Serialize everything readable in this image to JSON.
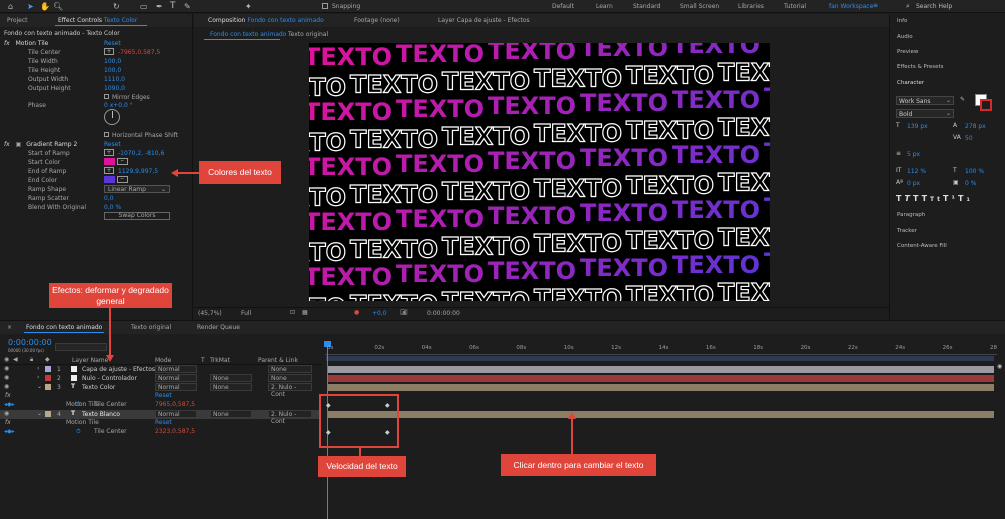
{
  "toolbar": {
    "snapping_label": "Snapping",
    "workspaces": [
      "Default",
      "Learn",
      "Standard",
      "Small Screen",
      "Libraries",
      "Tutorial"
    ],
    "active_workspace": "fan Workspace",
    "search_placeholder": "Search Help"
  },
  "left_panel": {
    "tab_project": "Project",
    "tab_effect_controls_prefix": "Effect Controls",
    "tab_effect_controls_layer": "Texto Color",
    "header": "Fondo con texto animado - Texto Color",
    "motion_tile": {
      "name": "Motion Tile",
      "reset": "Reset",
      "props": [
        {
          "label": "Tile Center",
          "value": "-7965,0,587,5",
          "color": "red",
          "crosshair": true
        },
        {
          "label": "Tile Width",
          "value": "100,0"
        },
        {
          "label": "Tile Height",
          "value": "100,0"
        },
        {
          "label": "Output Width",
          "value": "1110,0"
        },
        {
          "label": "Output Height",
          "value": "1090,0"
        }
      ],
      "mirror_edges": "Mirror Edges",
      "phase_label": "Phase",
      "phase_value": "0 x+0,0 °",
      "horizontal_phase_shift": "Horizontal Phase Shift"
    },
    "gradient_ramp": {
      "name": "Gradient Ramp 2",
      "reset": "Reset",
      "start_of_ramp_label": "Start of Ramp",
      "start_of_ramp_value": "-1070,2, -810,6",
      "start_color_label": "Start Color",
      "end_of_ramp_label": "End of Ramp",
      "end_of_ramp_value": "1129,9,997,5",
      "end_color_label": "End Color",
      "ramp_shape_label": "Ramp Shape",
      "ramp_shape_value": "Linear Ramp",
      "ramp_scatter_label": "Ramp Scatter",
      "ramp_scatter_value": "0,0",
      "blend_label": "Blend With Original",
      "blend_value": "0,0 %",
      "swap_colors": "Swap Colors",
      "start_color": "#e0119a",
      "end_color": "#5a35d8"
    }
  },
  "composition": {
    "tab_prefix": "Composition",
    "tab_name": "Fondo con texto animado",
    "footage_tab": "Footage (none)",
    "layer_tab": "Layer Capa de ajuste - Efectos",
    "subtab_active": "Fondo con texto animado",
    "subtab_other": "Texto original",
    "zoom": "(45,7%)",
    "resolution": "Full",
    "exposure": "+0,0",
    "timecode": "0:00:00:00",
    "tile_word": "TEXTO"
  },
  "right_panel": {
    "items_top": [
      "Info",
      "Audio",
      "Preview",
      "Effects & Presets"
    ],
    "character_title": "Character",
    "font_family": "Work Sans",
    "font_style": "Bold",
    "font_size": "139 px",
    "leading": "278 px",
    "tracking": "50",
    "stroke_width": "5 px",
    "vscale": "112 %",
    "hscale": "100 %",
    "baseline": "0 px",
    "tsume": "0 %",
    "items_bottom": [
      "Paragraph",
      "Tracker",
      "Content-Aware Fill"
    ]
  },
  "timeline": {
    "tab_name": "Fondo con texto animado",
    "tab_other": "Texto original",
    "tab_render": "Render Queue",
    "timecode": "0:00:00:00",
    "timecode_sub": "00000 (30.00 fps)",
    "columns": {
      "layer_name": "Layer Name",
      "mode": "Mode",
      "t": "T",
      "trkmat": "TrkMat",
      "parent": "Parent & Link"
    },
    "layers": [
      {
        "num": "1",
        "name": "Capa de ajuste - Efectos",
        "mode": "Normal",
        "trkmat": "",
        "parent": "None",
        "color": "#a8a8d8",
        "track": "#9a9aa0"
      },
      {
        "num": "2",
        "name": "Nulo - Controlador",
        "mode": "Normal",
        "trkmat": "None",
        "parent": "None",
        "color": "#c23b3b",
        "track": "#9b3a3a"
      },
      {
        "num": "3",
        "name": "Texto Color",
        "mode": "Normal",
        "trkmat": "None",
        "parent": "2. Nulo - Cont",
        "color": "#b8a78a",
        "track": "#8c7d66"
      },
      {
        "num": "4",
        "name": "Texto Blanco",
        "mode": "Normal",
        "trkmat": "None",
        "parent": "2. Nulo - Cont",
        "color": "#b8a78a",
        "track": "#8c7d66"
      }
    ],
    "sub_rows": {
      "fx_label": "fx",
      "reset": "Reset",
      "motion_tile": "Motion Tile",
      "tile_center": "Tile Center",
      "tile_center_value_3": "7965,0,587,5",
      "tile_center_value_4": "2323,0,587,5"
    },
    "ruler": [
      "0s",
      "02s",
      "04s",
      "06s",
      "08s",
      "10s",
      "12s",
      "14s",
      "16s",
      "18s",
      "20s",
      "22s",
      "24s",
      "26s",
      "28"
    ]
  },
  "annotations": {
    "colores": "Colores del texto",
    "efectos": "Efectos: deformar y degradado general",
    "velocidad": "Velocidad del texto",
    "clicar": "Clicar dentro para cambiar el texto",
    "color": "#e0453b"
  }
}
